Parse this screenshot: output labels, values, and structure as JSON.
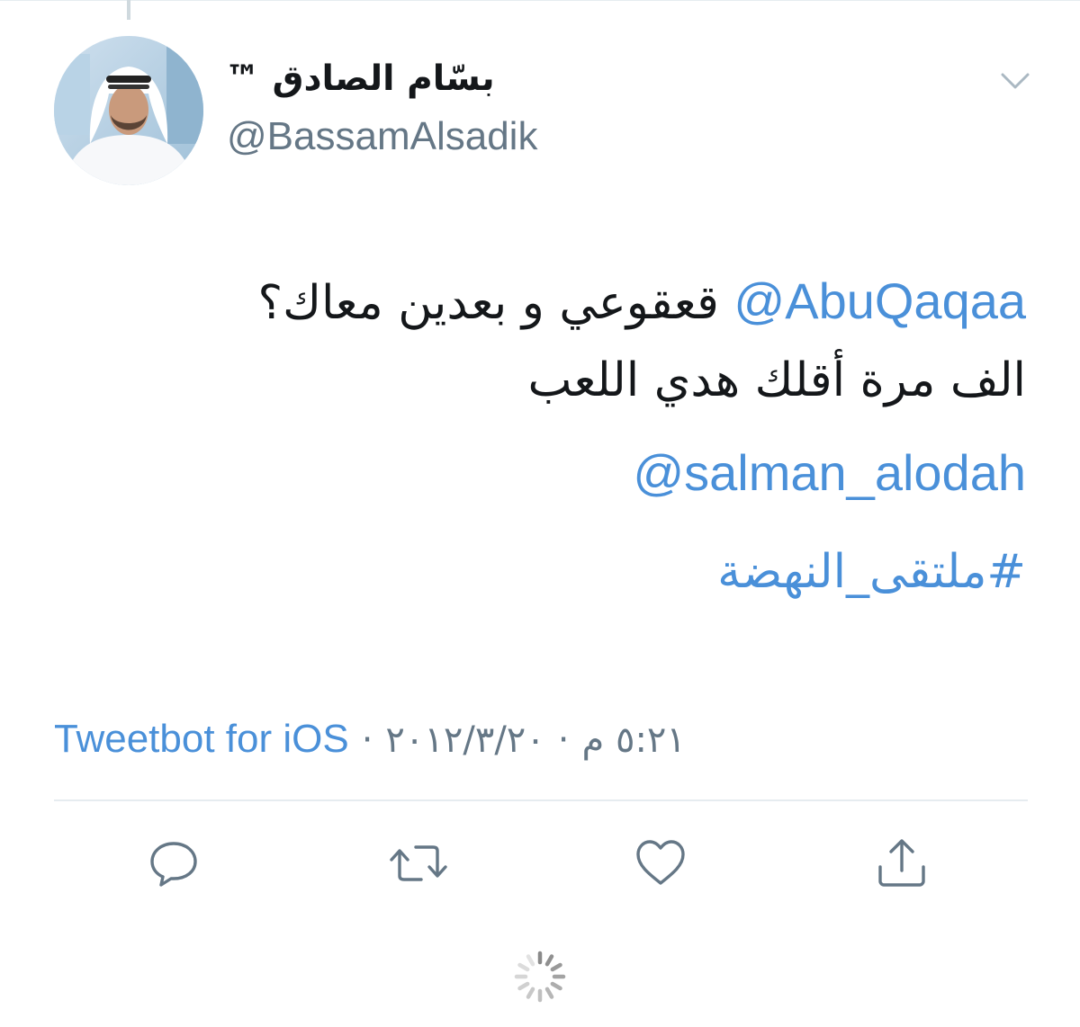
{
  "user": {
    "name": "بسّام الصادق ™",
    "handle": "@BassamAlsadik"
  },
  "tweet": {
    "mention_1": "@AbuQaqaa",
    "line_1_text": " قعقوعي و بعدين معاك؟",
    "line_2_text": "الف مرة أقلك هدي اللعب",
    "mention_2": "@salman_alodah",
    "hashtag": "#ملتقى_النهضة"
  },
  "meta": {
    "time": "٥:٢١ م",
    "separator": "·",
    "date": "٢٠١٢/٣/٢٠",
    "source": "Tweetbot for iOS"
  },
  "icons": {
    "menu": "chevron-down-icon",
    "reply": "reply-icon",
    "retweet": "retweet-icon",
    "like": "heart-icon",
    "share": "share-icon",
    "loading": "spinner-icon"
  },
  "colors": {
    "link": "#4a90d9",
    "text": "#14171a",
    "secondary": "#657786",
    "icon": "#657786"
  }
}
